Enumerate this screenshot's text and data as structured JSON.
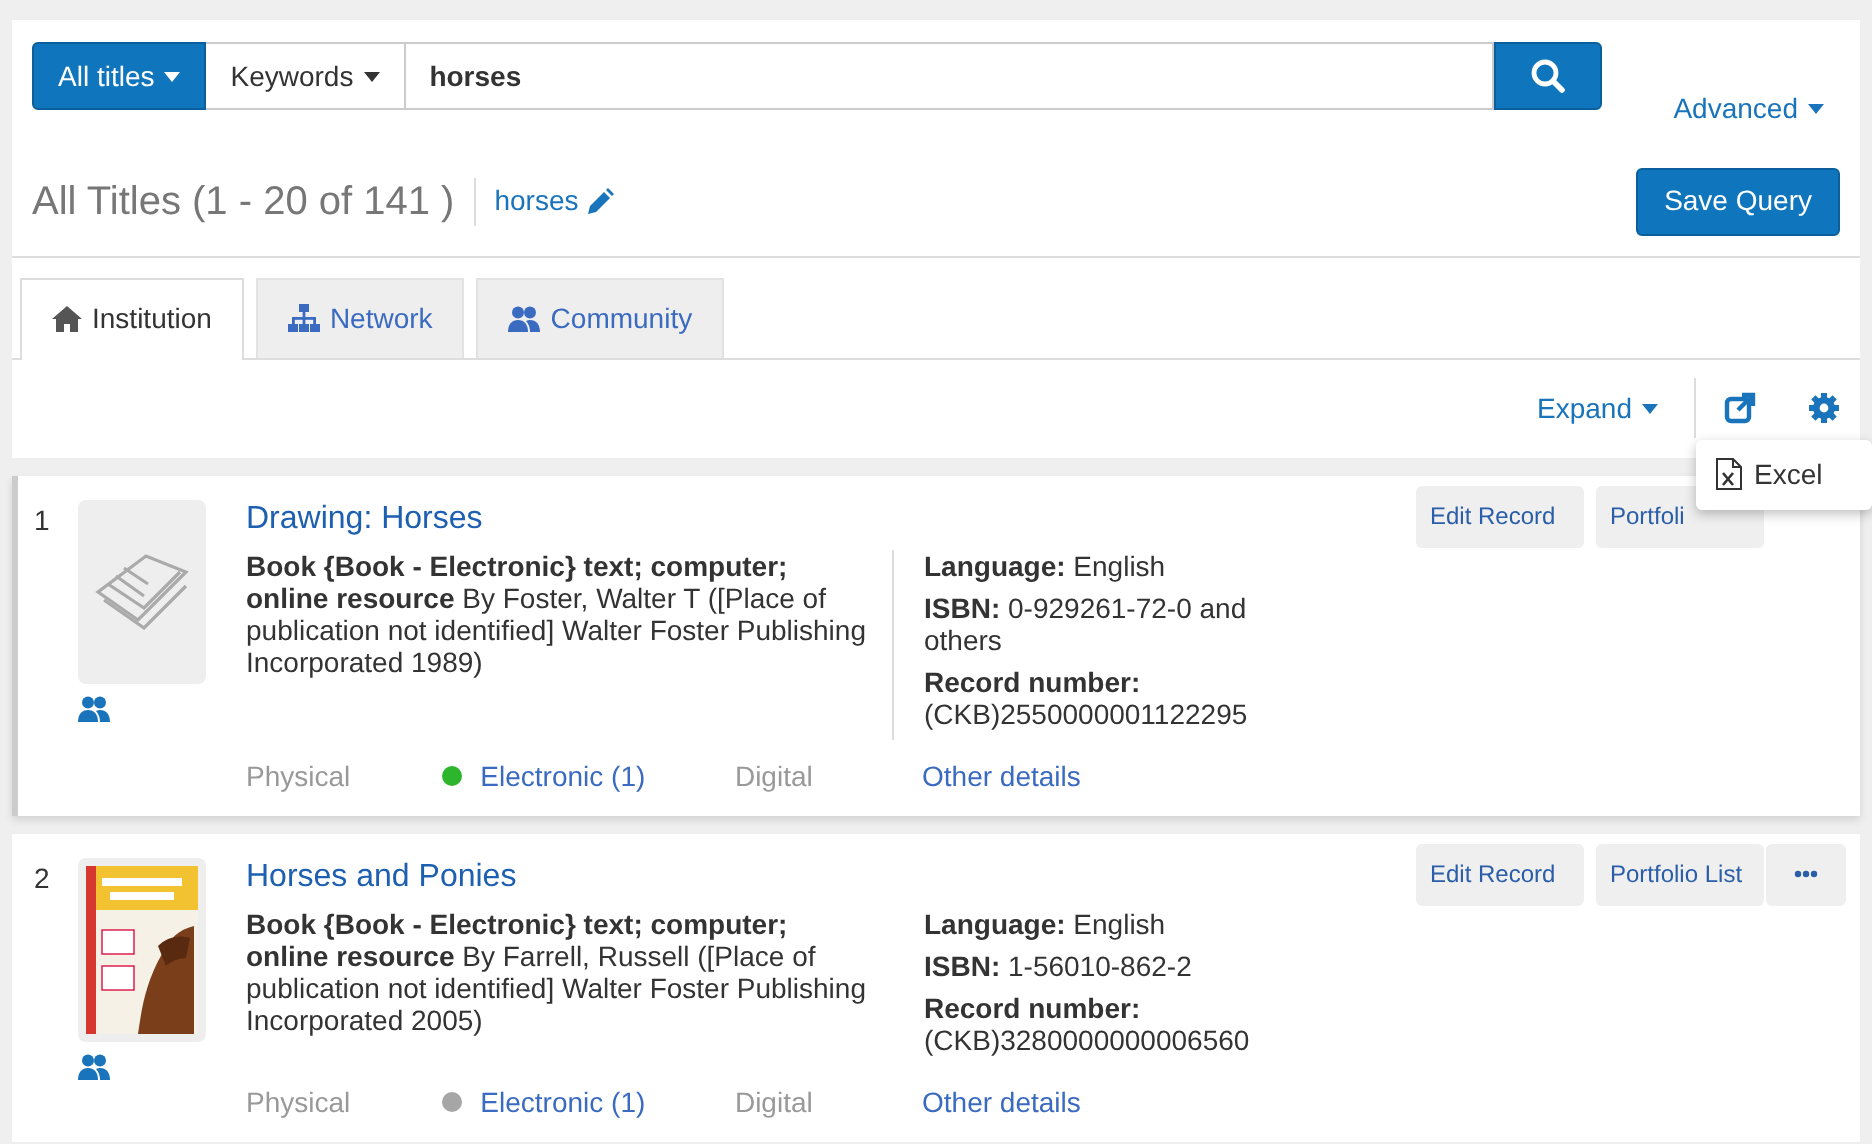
{
  "search": {
    "scope": "All titles",
    "field": "Keywords",
    "query": "horses",
    "advanced": "Advanced"
  },
  "header": {
    "title": "All Titles (1 - 20 of 141 )",
    "query_link": "horses",
    "save_button": "Save Query"
  },
  "tabs": [
    {
      "label": "Institution",
      "selected": true
    },
    {
      "label": "Network",
      "selected": false
    },
    {
      "label": "Community",
      "selected": false
    }
  ],
  "toolbar": {
    "expand": "Expand",
    "menu_open": true,
    "menu_items": [
      "Excel"
    ]
  },
  "results": [
    {
      "number": "1",
      "title": "Drawing: Horses",
      "selected": true,
      "description": "**Book {Book - Electronic} text; computer; online resource** By Foster, Walter T ([Place of publication not identified] Walter Foster Publishing Incorporated 1989)",
      "details": [
        "**Language:** English",
        "**ISBN:** 0-929261-72-0 and others",
        "**Record number:** (CKB)2550000001122295"
      ],
      "availability": [
        {
          "label": "Physical",
          "available": false
        },
        {
          "label": "Electronic (1)",
          "available": true,
          "color": "#2db52d"
        },
        {
          "label": "Digital",
          "available": false
        }
      ],
      "other_link": "Other details",
      "actions": [
        {
          "kind": "text",
          "label": "Edit Record"
        },
        {
          "kind": "text",
          "label": "Portfoli"
        }
      ]
    },
    {
      "number": "2",
      "title": "Horses and Ponies",
      "selected": false,
      "description": "**Book {Book - Electronic} text; computer; online resource** By Farrell, Russell ([Place of publication not identified] Walter Foster Publishing Incorporated 2005)",
      "details": [
        "**Language:** English",
        "**ISBN:** 1-56010-862-2",
        "**Record number:** (CKB)3280000000006560"
      ],
      "availability": [
        {
          "label": "Physical",
          "available": false
        },
        {
          "label": "Electronic (1)",
          "available": true,
          "color": "#a6a6a6"
        },
        {
          "label": "Digital",
          "available": false
        }
      ],
      "other_link": "Other details",
      "actions": [
        {
          "kind": "text",
          "label": "Edit Record"
        },
        {
          "kind": "text",
          "label": "Portfolio List"
        },
        {
          "kind": "more"
        }
      ]
    }
  ]
}
